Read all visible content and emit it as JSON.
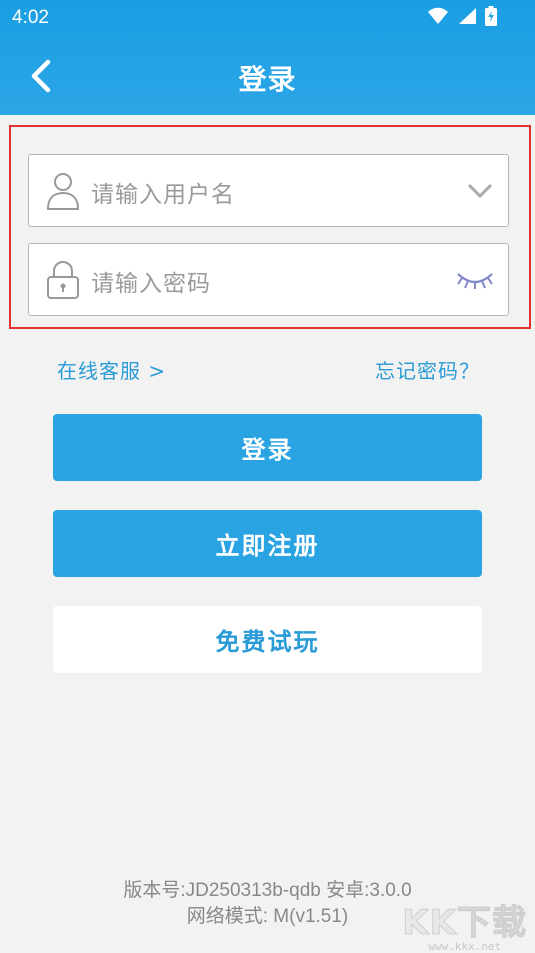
{
  "status_bar": {
    "time": "4:02",
    "icons": [
      "wifi-icon",
      "signal-icon",
      "battery-icon"
    ]
  },
  "header": {
    "title": "登录",
    "back_icon": "chevron-left-icon"
  },
  "form": {
    "username": {
      "placeholder": "请输入用户名",
      "icon": "user-icon",
      "trailing_icon": "chevron-down-icon"
    },
    "password": {
      "placeholder": "请输入密码",
      "icon": "lock-icon",
      "trailing_icon": "eye-closed-icon"
    }
  },
  "links": {
    "customer_service": "在线客服 >",
    "forgot_password": "忘记密码？"
  },
  "buttons": {
    "login": "登录",
    "register": "立即注册",
    "trial": "免费试玩"
  },
  "footer": {
    "version": "版本号:JD250313b-qdb  安卓:3.0.0",
    "network": "网络模式: M(v1.51)"
  },
  "watermark": {
    "logo": "KK下载",
    "url": "www.kkx.net"
  },
  "colors": {
    "primary": "#2aa3e3",
    "link": "#2a9bd6",
    "highlight_border": "#e3322f",
    "background": "#f2f2f2"
  }
}
